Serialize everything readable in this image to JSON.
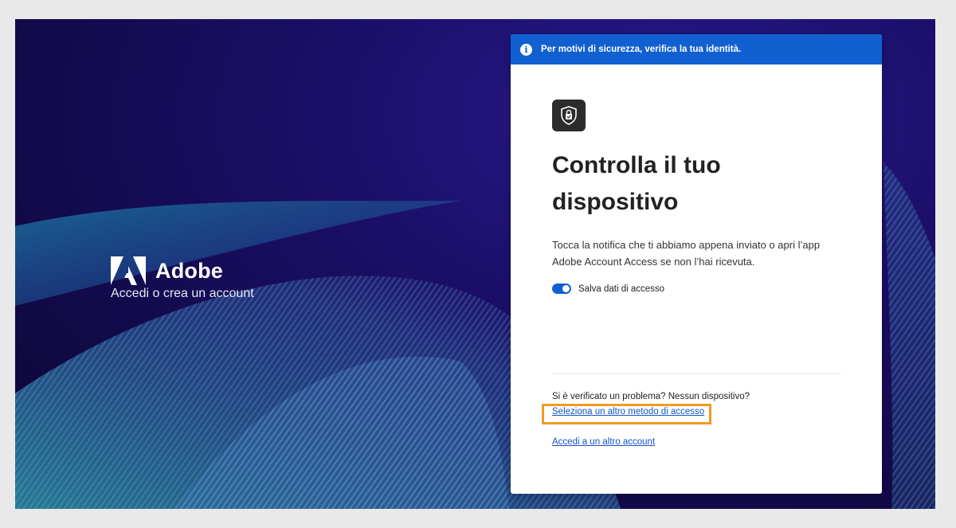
{
  "brand": {
    "name": "Adobe",
    "subtitle": "Accedi o crea un account"
  },
  "banner": {
    "icon": "info-icon",
    "text": "Per motivi di sicurezza, verifica la tua identità."
  },
  "card": {
    "app_icon": "shield-lock-icon",
    "title_line1": "Controlla il tuo",
    "title_line2": "dispositivo",
    "description_line1": "Tocca la notifica che ti abbiamo appena inviato o apri l’app",
    "description_line2": "Adobe Account Access se non l’hai ricevuta.",
    "toggle_label": "Salva dati di accesso",
    "toggle_on": true,
    "problem_text": "Si è verificato un problema? Nessun dispositivo?",
    "other_method_link": "Seleziona un altro metodo di accesso",
    "other_account_link": "Accedi a un altro account"
  },
  "colors": {
    "accent": "#1160d2",
    "highlight": "#f29a24",
    "link": "#1153c6"
  }
}
